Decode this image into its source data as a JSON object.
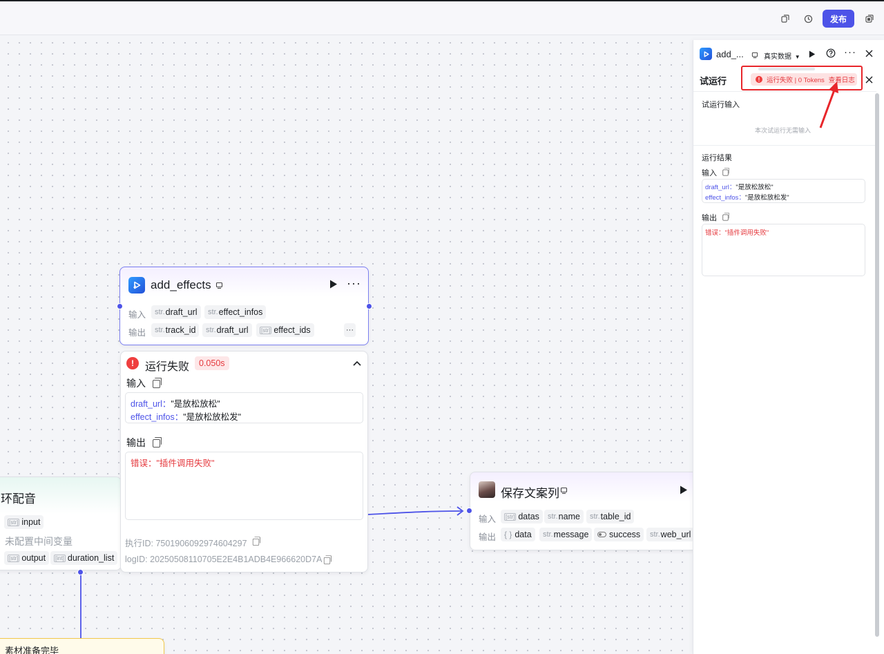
{
  "topbar": {
    "publish_label": "发布",
    "icons": [
      "copy-icon",
      "history-icon",
      "layout-icon"
    ]
  },
  "node_add_effects": {
    "title": "add_effects",
    "input_label": "输入",
    "output_label": "输出",
    "inputs": [
      {
        "type": "str.",
        "name": "draft_url"
      },
      {
        "type": "str.",
        "name": "effect_infos"
      }
    ],
    "outputs": [
      {
        "type": "str.",
        "name": "track_id"
      },
      {
        "type": "str.",
        "name": "draft_url"
      },
      {
        "type": "[str]",
        "name": "effect_ids"
      }
    ]
  },
  "result_card": {
    "status": "运行失败",
    "duration": "0.050s",
    "input_label": "输入",
    "output_label": "输出",
    "input_lines": [
      {
        "key": "draft_url：",
        "value": "\"是放松放松\""
      },
      {
        "key": "effect_infos：",
        "value": "\"是放松放松发\""
      }
    ],
    "error_text": "错误：\"插件调用失败\"",
    "exec_id": "执行ID: 7501906092974604297",
    "log_id": "logID: 20250508110705E2E4B1ADB4E966620D7A"
  },
  "node_loop": {
    "title": "环配音",
    "input_tag": {
      "type": "[str]",
      "name": "input"
    },
    "no_vars": "未配置中间变量",
    "outputs": [
      {
        "type": "[str]",
        "name": "output"
      },
      {
        "type": "[int]",
        "name": "duration_list"
      }
    ]
  },
  "node_bottom": {
    "title": "素材准备完毕"
  },
  "node_save": {
    "title": "保存文案列",
    "input_label": "输入",
    "output_label": "输出",
    "inputs": [
      {
        "type": "[str]",
        "name": "datas"
      },
      {
        "type": "str.",
        "name": "name"
      },
      {
        "type": "str.",
        "name": "table_id"
      }
    ],
    "outputs": [
      {
        "type": "{ }",
        "name": "data"
      },
      {
        "type": "str.",
        "name": "message"
      },
      {
        "type": "toggle",
        "name": "success"
      },
      {
        "type": "str.",
        "name": "web_url"
      }
    ]
  },
  "side_panel": {
    "node_title": "add_...",
    "data_mode": "真实数据",
    "test_run_title": "试运行",
    "status_text": "运行失败 | 0 Tokens",
    "view_log": "查看日志",
    "test_input_title": "试运行输入",
    "no_input_text": "本次试运行无需输入",
    "run_result_title": "运行结果",
    "input_label": "输入",
    "output_label": "输出",
    "input_lines": [
      {
        "key": "draft_url：",
        "value": "\"是放松放松\""
      },
      {
        "key": "effect_infos：",
        "value": "\"是放松放松发\""
      }
    ],
    "error_text": "错误：\"插件调用失败\""
  },
  "colors": {
    "accent": "#4d53e8",
    "error": "#e5393e",
    "annotation": "#e8262b"
  }
}
